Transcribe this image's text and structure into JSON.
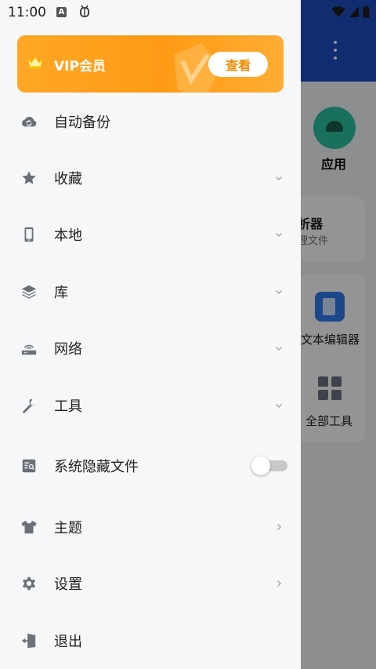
{
  "status_bar": {
    "time": "11:00",
    "icons": [
      "a-icon",
      "bug-icon",
      "wifi-icon",
      "signal-icon",
      "battery-icon"
    ]
  },
  "background": {
    "app_label": "应用",
    "card1_title": "析器",
    "card1_sub": "理文件",
    "text_editor": "文本编辑器",
    "all_tools": "全部工具"
  },
  "vip": {
    "label": "VIP会员",
    "button": "查看",
    "icon": "crown-icon"
  },
  "menu": {
    "backup": "自动备份",
    "favorites": "收藏",
    "local": "本地",
    "library": "库",
    "network": "网络",
    "tools": "工具",
    "hidden_files": "系统隐藏文件",
    "theme": "主题",
    "settings": "设置",
    "logout": "退出"
  },
  "hidden_files_toggle": "off",
  "colors": {
    "vip_gradient_start": "#ffa726",
    "vip_button_text": "#f08a00",
    "drawer_bg": "#f6f7f9",
    "icon_gray": "#6b6f78",
    "header_blue": "#1e4fbf"
  }
}
